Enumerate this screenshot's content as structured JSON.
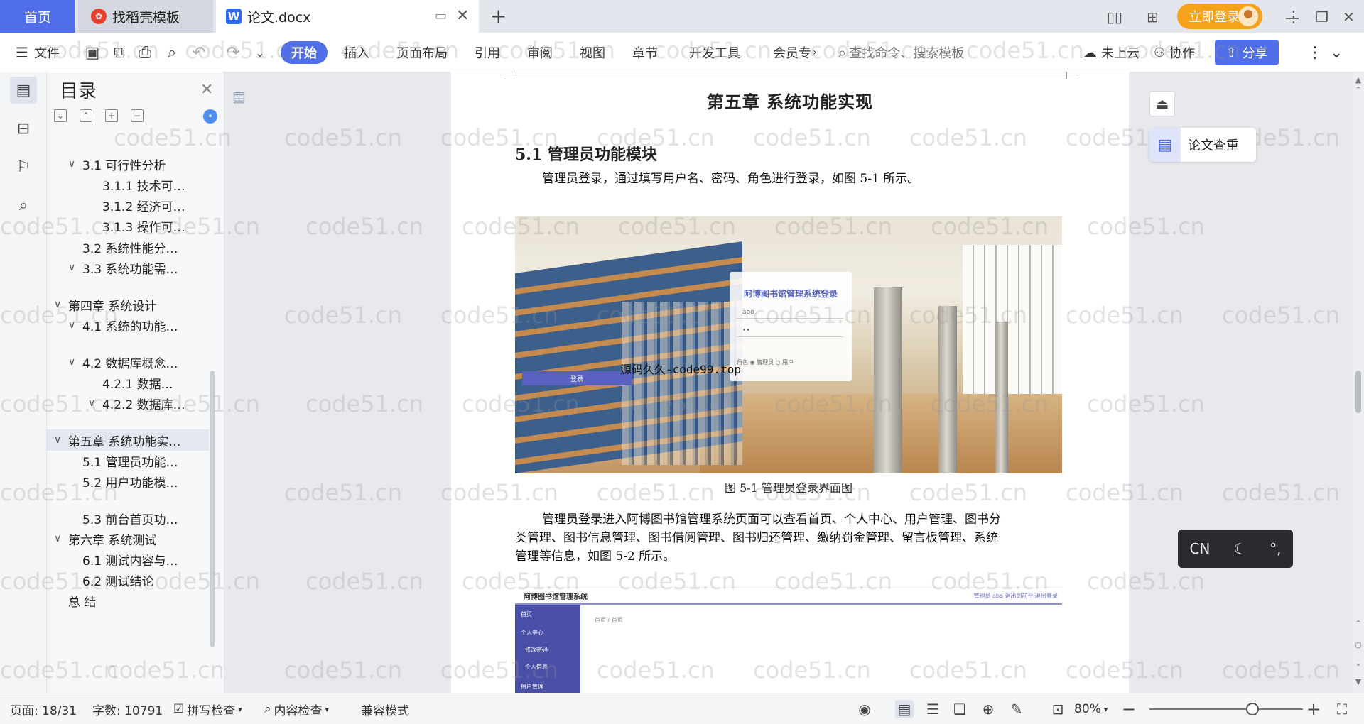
{
  "tabs": {
    "home": "首页",
    "docer": "找稻壳模板",
    "doc": "论文.docx",
    "login": "立即登录"
  },
  "ribbon": {
    "file": "文件",
    "menus": [
      "开始",
      "插入",
      "页面布局",
      "引用",
      "审阅",
      "视图",
      "章节",
      "开发工具",
      "会员专"
    ],
    "search_placeholder": "查找命令、搜索模板",
    "cloud": "未上云",
    "collab": "协作",
    "share": "分享"
  },
  "toc": {
    "title": "目录",
    "items": [
      {
        "label": "3.1 可行性分析",
        "level": 1,
        "chev": "∨"
      },
      {
        "label": "3.1.1  技术可…",
        "level": 2,
        "chev": ""
      },
      {
        "label": "3.1.2 经济可…",
        "level": 2,
        "chev": ""
      },
      {
        "label": "3.1.3 操作可…",
        "level": 2,
        "chev": ""
      },
      {
        "label": "3.2 系统性能分…",
        "level": 1,
        "chev": ""
      },
      {
        "label": "3.3 系统功能需…",
        "level": 1,
        "chev": "∨"
      },
      {
        "label": "第四章 系统设计",
        "level": 0,
        "chev": "∨"
      },
      {
        "label": "4.1 系统的功能…",
        "level": 1,
        "chev": "∨"
      },
      {
        "label": "4.2 数据库概念…",
        "level": 1,
        "chev": "∨"
      },
      {
        "label": "4.2.1  数据…",
        "level": 2,
        "chev": ""
      },
      {
        "label": "4.2.2 数据库…",
        "level": 2,
        "chev": "∨"
      },
      {
        "label": "第五章 系统功能实…",
        "level": 0,
        "chev": "∨"
      },
      {
        "label": "5.1 管理员功能…",
        "level": 1,
        "chev": ""
      },
      {
        "label": "5.2 用户功能模…",
        "level": 1,
        "chev": ""
      },
      {
        "label": "5.3 前台首页功…",
        "level": 1,
        "chev": ""
      },
      {
        "label": "第六章 系统测试",
        "level": 0,
        "chev": "∨"
      },
      {
        "label": "6.1 测试内容与…",
        "level": 1,
        "chev": ""
      },
      {
        "label": "6.2 测试结论",
        "level": 1,
        "chev": ""
      },
      {
        "label": "总 结",
        "level": 0,
        "chev": ""
      }
    ],
    "selected_index": 11
  },
  "document": {
    "chapter_title": "第五章  系统功能实现",
    "section_title": "5.1 管理员功能模块",
    "para1": "管理员登录，通过填写用户名、密码、角色进行登录，如图 5-1 所示。",
    "login_title": "阿博图书馆管理系统登录",
    "login_user": "abo",
    "login_pass": "••",
    "login_role": "角色  ◉ 管理员  ○ 用户",
    "login_btn": "登录",
    "overlay": "源码久久-code99.top",
    "caption1": "图 5-1 管理员登录界面图",
    "para2_line1": "管理员登录进入阿博图书馆管理系统页面可以查看首页、个人中心、用户管理、图书分",
    "para2_line2": "类管理、图书信息管理、图书借阅管理、图书归还管理、缴纳罚金管理、留言板管理、系统",
    "para2_line3": "管理等信息，如图 5-2 所示。",
    "fig2_brand": "阿博图书馆管理系统",
    "fig2_right": "管理员 abo  退出到前台  退出登录",
    "fig2_menu": [
      "首页",
      "个人中心",
      "修改密码",
      "个人信息",
      "用户管理"
    ],
    "fig2_crumb": "首页 / 首页"
  },
  "watermark": "code51.cn",
  "right_panel": {
    "check": "论文查重",
    "cn_widget": "CN"
  },
  "status": {
    "page": "页面: 18/31",
    "words": "字数: 10791",
    "spell": "拼写检查",
    "content": "内容检查",
    "compat": "兼容模式",
    "zoom": "80%",
    "zoom_fraction": 0.3
  },
  "colors": {
    "accent": "#4f6ee8",
    "login": "#f6a31b"
  }
}
